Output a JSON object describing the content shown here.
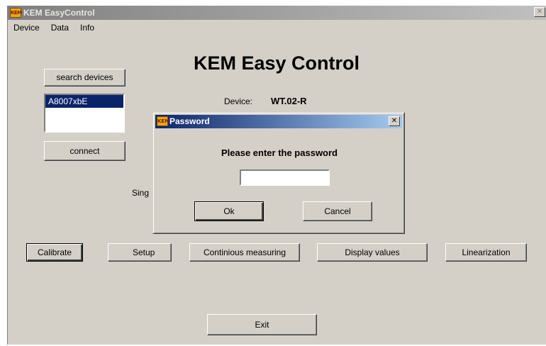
{
  "window": {
    "title": "KEM EasyControl",
    "icon_text": "KEM"
  },
  "menu": [
    "Device",
    "Data",
    "Info"
  ],
  "left_panel": {
    "search_button": "search devices",
    "device_list": [
      "A8007xbE"
    ],
    "connect_button": "connect"
  },
  "main": {
    "heading": "KEM Easy Control",
    "device_label": "Device:",
    "device_value": "WT.02-R",
    "sing_label": "Sing"
  },
  "actions": {
    "calibrate": "Calibrate",
    "setup": "Setup",
    "continuous": "Continious measuring",
    "display": "Display values",
    "linearization": "Linearization",
    "exit": "Exit"
  },
  "dialog": {
    "title": "Password",
    "icon_text": "KEM",
    "prompt": "Please enter the password",
    "password_value": "",
    "ok": "Ok",
    "cancel": "Cancel"
  }
}
